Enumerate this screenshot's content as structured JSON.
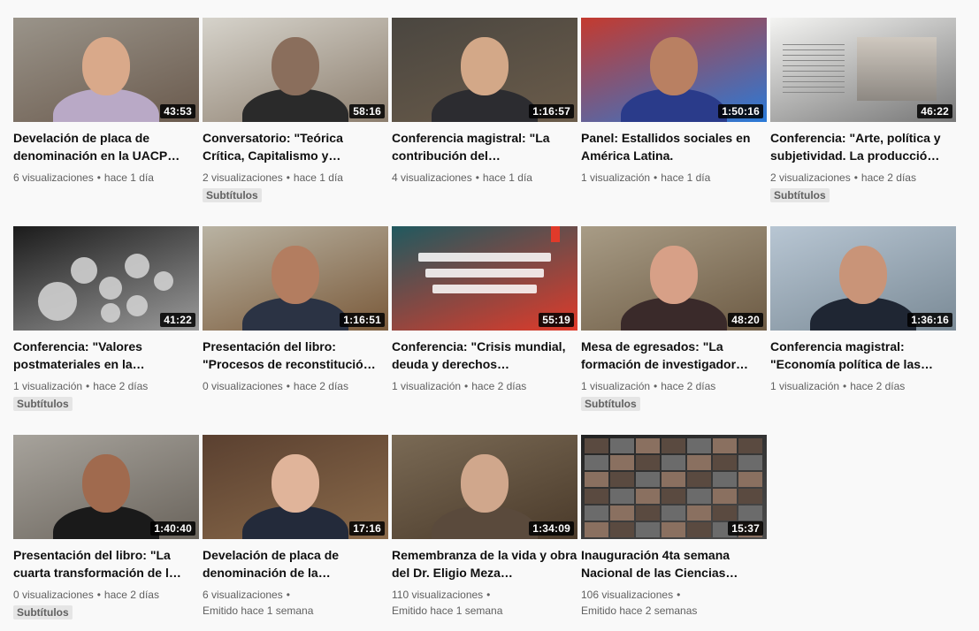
{
  "rows": [
    [
      {
        "title": "Develación de placa de denominación en la UACP…",
        "duration": "43:53",
        "views": "6 visualizaciones",
        "age": "hace 1 día",
        "badge": "",
        "thumb": {
          "bg": "#9a948a",
          "accent": "#6a5a4d",
          "skin": "#d9a98a",
          "shirt": "#b9a9c6"
        }
      },
      {
        "title": "Conversatorio: \"Teórica Crítica, Capitalismo y…",
        "duration": "58:16",
        "views": "2 visualizaciones",
        "age": "hace 1 día",
        "badge": "Subtítulos",
        "thumb": {
          "bg": "#d6d3cb",
          "accent": "#8c7e6e",
          "skin": "#8a6e5c",
          "shirt": "#2a2a2a"
        }
      },
      {
        "title": "Conferencia magistral: \"La contribución del…",
        "duration": "1:16:57",
        "views": "4 visualizaciones",
        "age": "hace 1 día",
        "badge": "",
        "thumb": {
          "bg": "#4a4640",
          "accent": "#6b5c4a",
          "skin": "#d3a888",
          "shirt": "#2c2c30"
        }
      },
      {
        "title": "Panel: Estallidos sociales en América Latina.",
        "duration": "1:50:16",
        "views": "1 visualización",
        "age": "hace 1 día",
        "badge": "",
        "thumb": {
          "bg": "#c43a2e",
          "accent": "#2a7ad8",
          "skin": "#b98062",
          "shirt": "#2a3b8a"
        }
      },
      {
        "title": "Conferencia: \"Arte, política y subjetividad. La producció…",
        "duration": "46:22",
        "views": "2 visualizaciones",
        "age": "hace 2 días",
        "badge": "Subtítulos",
        "thumb": {
          "bg": "#f4f4f2",
          "accent": "#777",
          "skin": "#aaa",
          "shirt": "#555"
        }
      }
    ],
    [
      {
        "title": "Conferencia: \"Valores postmateriales en la…",
        "duration": "41:22",
        "views": "1 visualización",
        "age": "hace 2 días",
        "badge": "Subtítulos",
        "thumb": {
          "bg": "#1b1b1b",
          "accent": "#9a9a9a",
          "skin": "#d9d9d9",
          "shirt": "#444"
        }
      },
      {
        "title": "Presentación del libro: \"Procesos de reconstitució…",
        "duration": "1:16:51",
        "views": "0 visualizaciones",
        "age": "hace 2 días",
        "badge": "",
        "thumb": {
          "bg": "#b9b3a3",
          "accent": "#7a5a3a",
          "skin": "#b37d60",
          "shirt": "#2b3344"
        }
      },
      {
        "title": "Conferencia: \"Crisis mundial, deuda y derechos…",
        "duration": "55:19",
        "views": "1 visualización",
        "age": "hace 2 días",
        "badge": "",
        "thumb": {
          "bg": "#20595f",
          "accent": "#e03a2a",
          "skin": "#ffffff",
          "shirt": "#20595f"
        }
      },
      {
        "title": "Mesa de egresados: \"La formación de investigador…",
        "duration": "48:20",
        "views": "1 visualización",
        "age": "hace 2 días",
        "badge": "Subtítulos",
        "thumb": {
          "bg": "#a89c86",
          "accent": "#6d5b44",
          "skin": "#d7a087",
          "shirt": "#3a2a2a"
        }
      },
      {
        "title": "Conferencia magistral: \"Economía política de las…",
        "duration": "1:36:16",
        "views": "1 visualización",
        "age": "hace 2 días",
        "badge": "",
        "thumb": {
          "bg": "#b8c6d3",
          "accent": "#7a8a96",
          "skin": "#c99478",
          "shirt": "#1f2633"
        }
      }
    ],
    [
      {
        "title": "Presentación del libro: \"La cuarta transformación de l…",
        "duration": "1:40:40",
        "views": "0 visualizaciones",
        "age": "hace 2 días",
        "badge": "Subtítulos",
        "thumb": {
          "bg": "#a7a39c",
          "accent": "#6a645c",
          "skin": "#a06a4e",
          "shirt": "#1a1a1a"
        }
      },
      {
        "title": "Develación de placa de denominación de la…",
        "duration": "17:16",
        "views": "6 visualizaciones",
        "age": "Emitido hace 1 semana",
        "badge": "",
        "thumb": {
          "bg": "#5a4030",
          "accent": "#8a6a4a",
          "skin": "#e0b49a",
          "shirt": "#232a3a"
        }
      },
      {
        "title": "Remembranza de la vida y obra del Dr. Eligio Meza…",
        "duration": "1:34:09",
        "views": "110 visualizaciones",
        "age": "Emitido hace 1 semana",
        "badge": "",
        "thumb": {
          "bg": "#7a6a55",
          "accent": "#4a3a2a",
          "skin": "#d0a78c",
          "shirt": "#5a4a3c"
        }
      },
      {
        "title": "Inauguración 4ta semana Nacional de las Ciencias…",
        "duration": "15:37",
        "views": "106 visualizaciones",
        "age": "Emitido hace 2 semanas",
        "badge": "",
        "thumb": {
          "bg": "#222222",
          "accent": "#4d4d4d",
          "skin": "#c49274",
          "shirt": "#333"
        }
      }
    ]
  ],
  "separator": "•"
}
